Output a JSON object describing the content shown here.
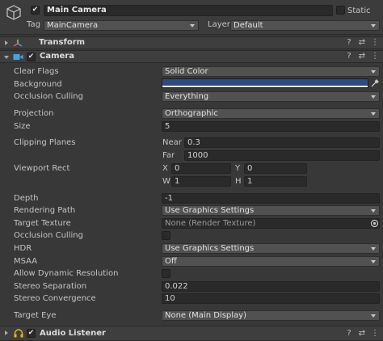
{
  "gameobject": {
    "name": "Main Camera",
    "active_checked": "✔",
    "static_label": "Static",
    "tag_label": "Tag",
    "tag_value": "MainCamera",
    "layer_label": "Layer",
    "layer_value": "Default"
  },
  "components": {
    "transform": {
      "title": "Transform"
    },
    "camera": {
      "title": "Camera",
      "enabled": "✔"
    },
    "audio_listener": {
      "title": "Audio Listener",
      "enabled": "✔"
    }
  },
  "header_icons": {
    "help": "?",
    "preset": "⇄",
    "menu": "⋮"
  },
  "camera": {
    "clear_flags": {
      "label": "Clear Flags",
      "value": "Solid Color"
    },
    "background": {
      "label": "Background",
      "color": "#2f4a7f"
    },
    "occlusion_culling_mask": {
      "label": "Occlusion Culling",
      "value": "Everything"
    },
    "projection": {
      "label": "Projection",
      "value": "Orthographic"
    },
    "size": {
      "label": "Size",
      "value": "5"
    },
    "clipping_planes": {
      "label": "Clipping Planes",
      "near_label": "Near",
      "near_value": "0.3",
      "far_label": "Far",
      "far_value": "1000"
    },
    "viewport_rect": {
      "label": "Viewport Rect",
      "x_label": "X",
      "x_value": "0",
      "y_label": "Y",
      "y_value": "0",
      "w_label": "W",
      "w_value": "1",
      "h_label": "H",
      "h_value": "1"
    },
    "depth": {
      "label": "Depth",
      "value": "-1"
    },
    "rendering_path": {
      "label": "Rendering Path",
      "value": "Use Graphics Settings"
    },
    "target_texture": {
      "label": "Target Texture",
      "value": "None (Render Texture)"
    },
    "occlusion_culling": {
      "label": "Occlusion Culling"
    },
    "hdr": {
      "label": "HDR",
      "value": "Use Graphics Settings"
    },
    "msaa": {
      "label": "MSAA",
      "value": "Off"
    },
    "allow_dynamic_resolution": {
      "label": "Allow Dynamic Resolution"
    },
    "stereo_separation": {
      "label": "Stereo Separation",
      "value": "0.022"
    },
    "stereo_convergence": {
      "label": "Stereo Convergence",
      "value": "10"
    },
    "target_eye": {
      "label": "Target Eye",
      "value": "None (Main Display)"
    }
  }
}
